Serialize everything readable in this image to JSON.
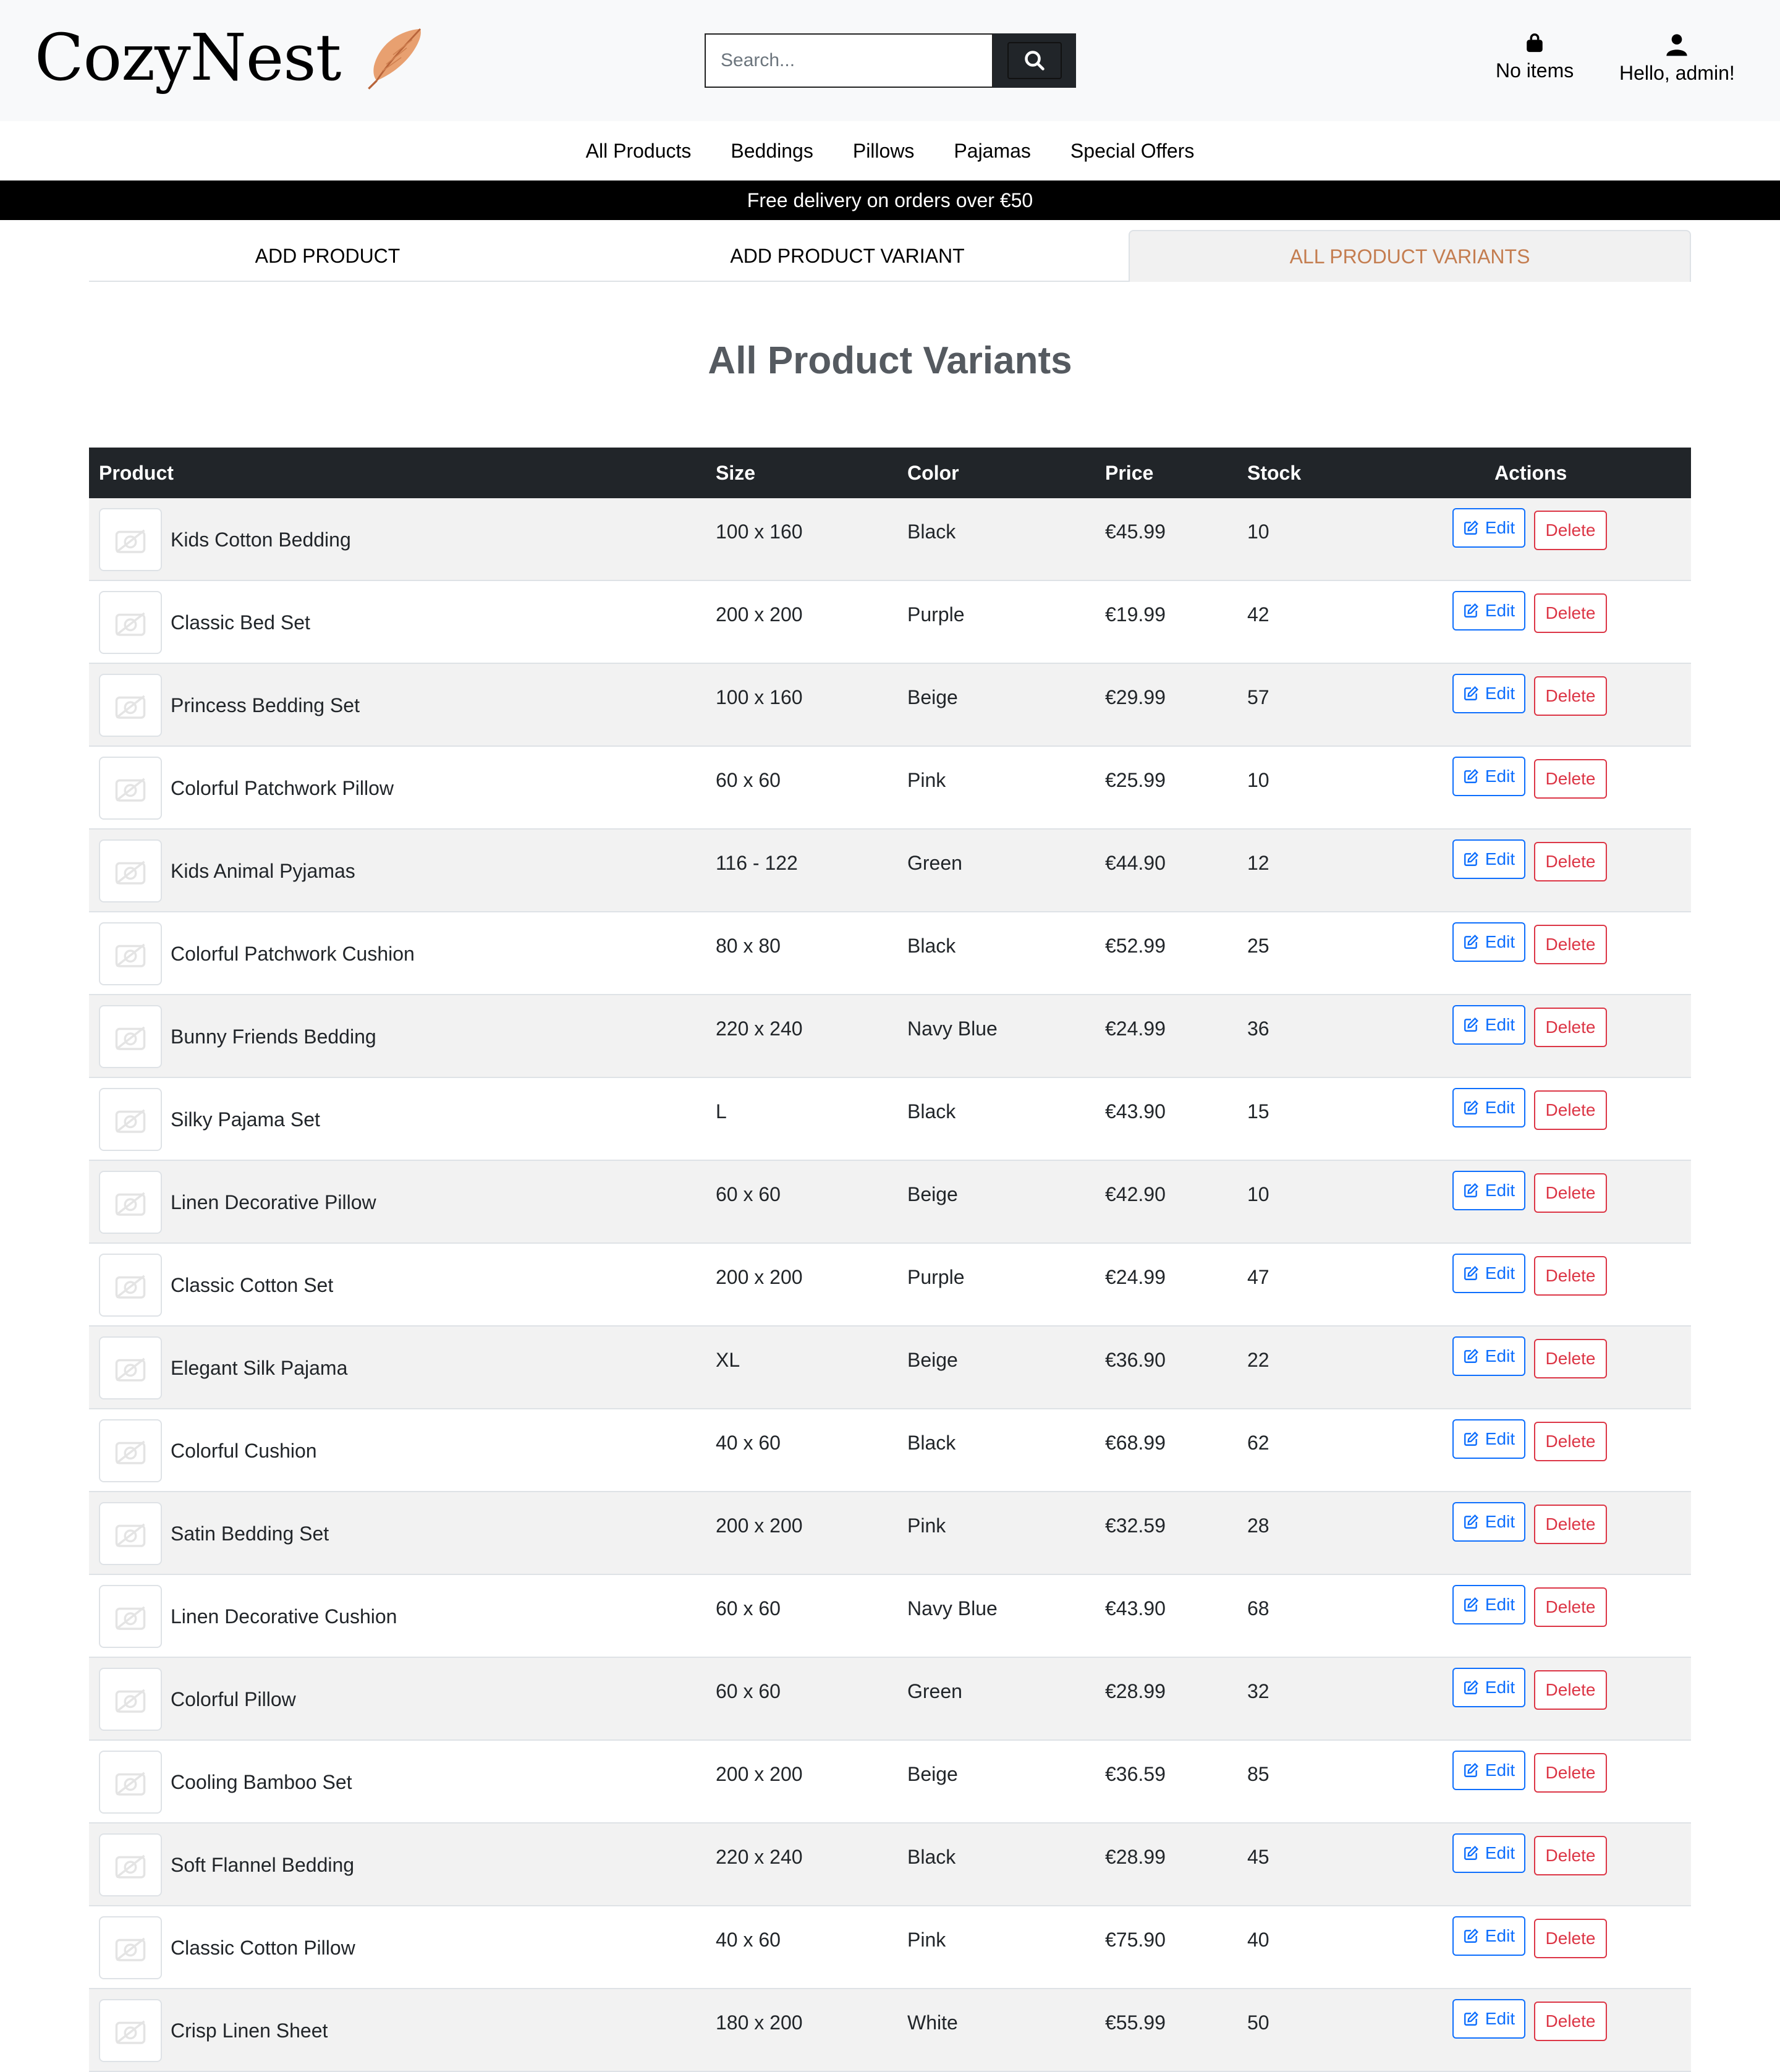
{
  "brand": {
    "name": "CozyNest"
  },
  "search": {
    "placeholder": "Search..."
  },
  "header": {
    "cart_label": "No items",
    "user_label": "Hello, admin!"
  },
  "nav": {
    "items": [
      "All Products",
      "Beddings",
      "Pillows",
      "Pajamas",
      "Special Offers"
    ]
  },
  "banner": {
    "text": "Free delivery on orders over €50"
  },
  "tabs": {
    "add_product": "ADD PRODUCT",
    "add_variant": "ADD PRODUCT VARIANT",
    "all_variants": "ALL PRODUCT VARIANTS"
  },
  "page": {
    "title": "All Product Variants"
  },
  "table": {
    "headers": {
      "product": "Product",
      "size": "Size",
      "color": "Color",
      "price": "Price",
      "stock": "Stock",
      "actions": "Actions"
    },
    "edit_label": "Edit",
    "delete_label": "Delete",
    "rows": [
      {
        "product": "Kids Cotton Bedding",
        "size": "100 x 160",
        "color": "Black",
        "price": "€45.99",
        "stock": "10"
      },
      {
        "product": "Classic Bed Set",
        "size": "200 x 200",
        "color": "Purple",
        "price": "€19.99",
        "stock": "42"
      },
      {
        "product": "Princess Bedding Set",
        "size": "100 x 160",
        "color": "Beige",
        "price": "€29.99",
        "stock": "57"
      },
      {
        "product": "Colorful Patchwork Pillow",
        "size": "60 x 60",
        "color": "Pink",
        "price": "€25.99",
        "stock": "10"
      },
      {
        "product": "Kids Animal Pyjamas",
        "size": "116 - 122",
        "color": "Green",
        "price": "€44.90",
        "stock": "12"
      },
      {
        "product": "Colorful Patchwork Cushion",
        "size": "80 x 80",
        "color": "Black",
        "price": "€52.99",
        "stock": "25"
      },
      {
        "product": "Bunny Friends Bedding",
        "size": "220 x 240",
        "color": "Navy Blue",
        "price": "€24.99",
        "stock": "36"
      },
      {
        "product": "Silky Pajama Set",
        "size": "L",
        "color": "Black",
        "price": "€43.90",
        "stock": "15"
      },
      {
        "product": "Linen Decorative Pillow",
        "size": "60 x 60",
        "color": "Beige",
        "price": "€42.90",
        "stock": "10"
      },
      {
        "product": "Classic Cotton Set",
        "size": "200 x 200",
        "color": "Purple",
        "price": "€24.99",
        "stock": "47"
      },
      {
        "product": "Elegant Silk Pajama",
        "size": "XL",
        "color": "Beige",
        "price": "€36.90",
        "stock": "22"
      },
      {
        "product": "Colorful Cushion",
        "size": "40 x 60",
        "color": "Black",
        "price": "€68.99",
        "stock": "62"
      },
      {
        "product": "Satin Bedding Set",
        "size": "200 x 200",
        "color": "Pink",
        "price": "€32.59",
        "stock": "28"
      },
      {
        "product": "Linen Decorative Cushion",
        "size": "60 x 60",
        "color": "Navy Blue",
        "price": "€43.90",
        "stock": "68"
      },
      {
        "product": "Colorful Pillow",
        "size": "60 x 60",
        "color": "Green",
        "price": "€28.99",
        "stock": "32"
      },
      {
        "product": "Cooling Bamboo Set",
        "size": "200 x 200",
        "color": "Beige",
        "price": "€36.59",
        "stock": "85"
      },
      {
        "product": "Soft Flannel Bedding",
        "size": "220 x 240",
        "color": "Black",
        "price": "€28.99",
        "stock": "45"
      },
      {
        "product": "Classic Cotton Pillow",
        "size": "40 x 60",
        "color": "Pink",
        "price": "€75.90",
        "stock": "40"
      },
      {
        "product": "Crisp Linen Sheet",
        "size": "180 x 200",
        "color": "White",
        "price": "€55.99",
        "stock": "50"
      }
    ]
  },
  "colors": {
    "accent": "#c47d50",
    "dark": "#212529",
    "primary": "#0d6efd",
    "danger": "#dc3545"
  },
  "icons": {
    "logo": "feather-icon",
    "search": "search-icon",
    "cart": "bag-icon",
    "user": "user-icon",
    "edit": "edit-icon",
    "thumb": "image-placeholder-icon"
  }
}
